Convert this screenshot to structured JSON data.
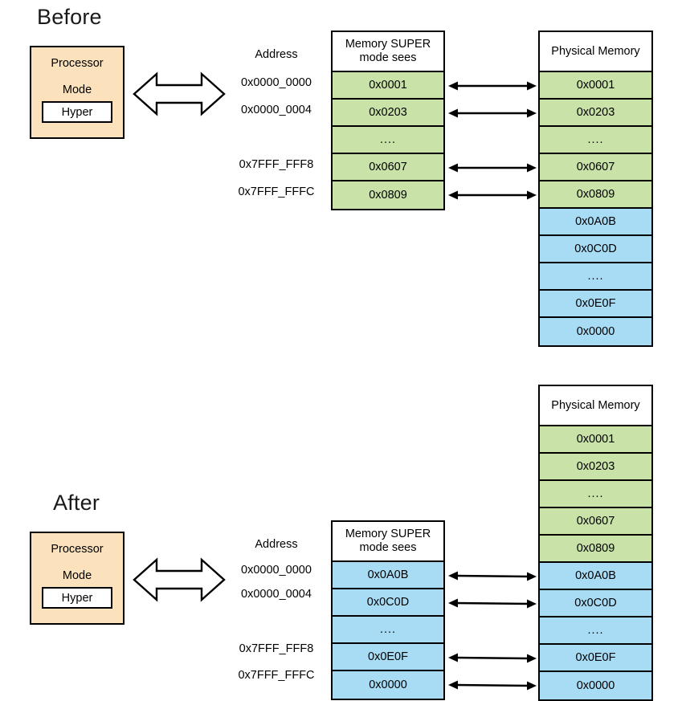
{
  "diagram": {
    "colors": {
      "processor_fill": "#fbe2bc",
      "green_row": "#c9e2a8",
      "blue_row": "#a8dcf5",
      "outline": "#000000",
      "page_background": "#ffffff"
    }
  },
  "before": {
    "title": "Before",
    "processor": {
      "title": "Processor",
      "mode_label": "Mode",
      "mode_value": "Hyper"
    },
    "big_arrow_name": "double-headed-arrow",
    "address_column": {
      "header": "Address",
      "items": [
        "0x0000_0000",
        "0x0000_0004",
        "",
        "0x7FFF_FFF8",
        "0x7FFF_FFFC"
      ]
    },
    "virtual_table": {
      "header_line1": "Memory SUPER",
      "header_line2": "mode sees",
      "rows": [
        {
          "value": "0x0001",
          "color": "green"
        },
        {
          "value": "0x0203",
          "color": "green"
        },
        {
          "value": "....",
          "color": "green"
        },
        {
          "value": "0x0607",
          "color": "green"
        },
        {
          "value": "0x0809",
          "color": "green"
        }
      ]
    },
    "physical_table": {
      "header": "Physical Memory",
      "rows": [
        {
          "value": "0x0001",
          "color": "green"
        },
        {
          "value": "0x0203",
          "color": "green"
        },
        {
          "value": "....",
          "color": "green"
        },
        {
          "value": "0x0607",
          "color": "green"
        },
        {
          "value": "0x0809",
          "color": "green"
        },
        {
          "value": "0x0A0B",
          "color": "blue"
        },
        {
          "value": "0x0C0D",
          "color": "blue"
        },
        {
          "value": "....",
          "color": "blue"
        },
        {
          "value": "0x0E0F",
          "color": "blue"
        },
        {
          "value": "0x0000",
          "color": "blue"
        }
      ]
    },
    "mappings": [
      0,
      1,
      3,
      4
    ]
  },
  "after": {
    "title": "After",
    "processor": {
      "title": "Processor",
      "mode_label": "Mode",
      "mode_value": "Hyper"
    },
    "big_arrow_name": "double-headed-arrow",
    "address_column": {
      "header": "Address",
      "items": [
        "0x0000_0000",
        "0x0000_0004",
        "",
        "0x7FFF_FFF8",
        "0x7FFF_FFFC"
      ]
    },
    "virtual_table": {
      "header_line1": "Memory SUPER",
      "header_line2": "mode sees",
      "rows": [
        {
          "value": "0x0A0B",
          "color": "blue"
        },
        {
          "value": "0x0C0D",
          "color": "blue"
        },
        {
          "value": "....",
          "color": "blue"
        },
        {
          "value": "0x0E0F",
          "color": "blue"
        },
        {
          "value": "0x0000",
          "color": "blue"
        }
      ]
    },
    "physical_table": {
      "header": "Physical Memory",
      "rows": [
        {
          "value": "0x0001",
          "color": "green"
        },
        {
          "value": "0x0203",
          "color": "green"
        },
        {
          "value": "....",
          "color": "green"
        },
        {
          "value": "0x0607",
          "color": "green"
        },
        {
          "value": "0x0809",
          "color": "green"
        },
        {
          "value": "0x0A0B",
          "color": "blue"
        },
        {
          "value": "0x0C0D",
          "color": "blue"
        },
        {
          "value": "....",
          "color": "blue"
        },
        {
          "value": "0x0E0F",
          "color": "blue"
        },
        {
          "value": "0x0000",
          "color": "blue"
        }
      ]
    },
    "mappings": [
      0,
      1,
      3,
      4
    ]
  }
}
